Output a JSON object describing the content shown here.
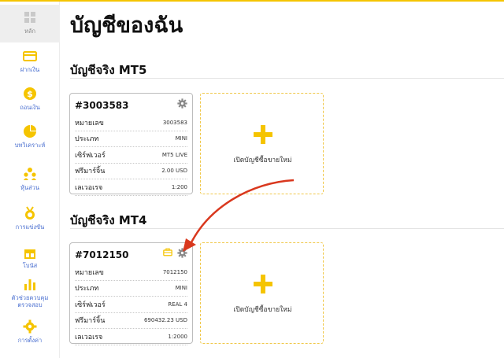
{
  "page": {
    "title": "บัญชีของฉัน"
  },
  "sidebar": {
    "items": [
      {
        "label": "หลัก",
        "icon": "dashboard-icon"
      },
      {
        "label": "ฝากเงิน",
        "icon": "card-icon"
      },
      {
        "label": "ถอนเงิน",
        "icon": "coin-icon"
      },
      {
        "label": "บทวิเคราะห์",
        "icon": "pie-chart-icon"
      },
      {
        "label": "หุ้นส่วน",
        "icon": "partners-icon"
      },
      {
        "label": "การแข่งขัน",
        "icon": "medal-icon"
      },
      {
        "label": "โบนัส",
        "icon": "gift-icon"
      },
      {
        "label": "ตัวช่วยควบคุม ตรวจสอบ",
        "icon": "bar-chart-icon"
      },
      {
        "label": "การตั้งค่า",
        "icon": "gear-icon"
      }
    ]
  },
  "sections": [
    {
      "title": "บัญชีจริง MT5",
      "account": {
        "id": "#3003583",
        "rows": [
          {
            "key": "หมายเลข",
            "value": "3003583"
          },
          {
            "key": "ประเภท",
            "value": "MINI"
          },
          {
            "key": "เซิร์ฟเวอร์",
            "value": "MT5 LIVE"
          },
          {
            "key": "ฟรีมาร์จิ้น",
            "value": "2.00 USD"
          },
          {
            "key": "เลเวอเรจ",
            "value": "1:200"
          }
        ]
      },
      "new_account_label": "เปิดบัญชีซื้อขายใหม่"
    },
    {
      "title": "บัญชีจริง MT4",
      "account": {
        "id": "#7012150",
        "rows": [
          {
            "key": "หมายเลข",
            "value": "7012150"
          },
          {
            "key": "ประเภท",
            "value": "MINI"
          },
          {
            "key": "เซิร์ฟเวอร์",
            "value": "REAL 4"
          },
          {
            "key": "ฟรีมาร์จิ้น",
            "value": "690432.23 USD"
          },
          {
            "key": "เลเวอเรจ",
            "value": "1:2000"
          }
        ]
      },
      "new_account_label": "เปิดบัญชีซื้อขายใหม่"
    }
  ],
  "colors": {
    "accent": "#f5c400",
    "annotation_arrow": "#d9381e",
    "sidebar_label": "#4a6fd0"
  }
}
